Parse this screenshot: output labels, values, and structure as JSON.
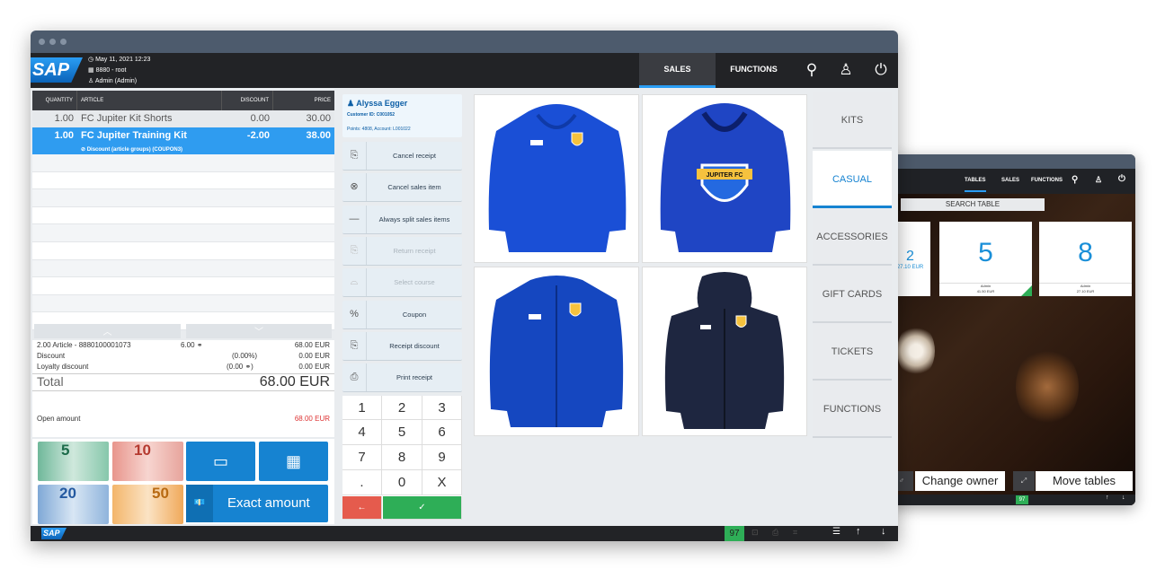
{
  "header": {
    "datetime": "May 11, 2021 12:23",
    "store": "8880 - root",
    "user": "Admin (Admin)",
    "tabs": [
      "SALES",
      "FUNCTIONS"
    ],
    "logo": "SAP"
  },
  "table": {
    "headers": [
      "QUANTITY",
      "ARTICLE",
      "DISCOUNT",
      "PRICE"
    ],
    "rows": [
      {
        "qty": "1.00",
        "article": "FC Jupiter Kit Shorts",
        "discount": "0.00",
        "price": "30.00"
      },
      {
        "qty": "1.00",
        "article": "FC Jupiter Training Kit",
        "discount": "-2.00",
        "price": "38.00",
        "sub": "Discount (article groups) (COUPON3)"
      }
    ]
  },
  "totals": {
    "articles": "2.00 Article - 8880100001073",
    "points": "6.00",
    "articles_amount": "68.00 EUR",
    "discount_label": "Discount",
    "discount_pct": "(0.00%)",
    "discount_amount": "0.00 EUR",
    "loyalty_label": "Loyalty discount",
    "loyalty_pts": "(0.00",
    "loyalty_amount": "0.00 EUR",
    "total_label": "Total",
    "total_amount": "68.00 EUR",
    "open_label": "Open amount",
    "open_amount": "68.00 EUR"
  },
  "payment": {
    "notes": [
      "5",
      "10",
      "20",
      "50"
    ],
    "exact": "Exact amount"
  },
  "customer": {
    "name": "Alyssa Egger",
    "id": "Customer ID: C001052",
    "points": "Points: 4808, Account: L001022"
  },
  "actions": [
    {
      "label": "Cancel receipt",
      "enabled": true
    },
    {
      "label": "Cancel sales item",
      "enabled": true
    },
    {
      "label": "Always split sales items",
      "enabled": true
    },
    {
      "label": "Return receipt",
      "enabled": false
    },
    {
      "label": "Select course",
      "enabled": false
    },
    {
      "label": "Coupon",
      "enabled": true
    },
    {
      "label": "Receipt discount",
      "enabled": true
    },
    {
      "label": "Print receipt",
      "enabled": true
    }
  ],
  "keypad": [
    "1",
    "2",
    "3",
    "4",
    "5",
    "6",
    "7",
    "8",
    "9",
    ".",
    "0",
    "X"
  ],
  "categories": [
    "KITS",
    "CASUAL",
    "ACCESSORIES",
    "GIFT CARDS",
    "TICKETS",
    "FUNCTIONS"
  ],
  "products": [
    {
      "badge": "",
      "color": "#1a4fd6"
    },
    {
      "badge": "JUPITER FC",
      "color": "#1f45c4"
    },
    {
      "badge": "",
      "color": "#1547c0"
    },
    {
      "badge": "",
      "color": "#1e2640"
    }
  ],
  "footer": {
    "count": "97"
  },
  "back": {
    "tabs": [
      "TABLES",
      "SALES",
      "FUNCTIONS"
    ],
    "search": "SEARCH TABLE",
    "tables": [
      {
        "num": "2",
        "amount": "27.10 EUR"
      },
      {
        "num": "5",
        "user": "Admin",
        "amount": "41.50 EUR"
      },
      {
        "num": "8",
        "user": "Admin",
        "amount": "27.10 EUR"
      }
    ],
    "buttons": [
      "Change owner",
      "Move tables"
    ],
    "footer_count": "97"
  },
  "colors": {
    "accent": "#1683d1",
    "header": "#222326",
    "selected_row": "#2f9cf0",
    "pay_green": "#2eae57",
    "pay_red": "#e55b4d"
  }
}
